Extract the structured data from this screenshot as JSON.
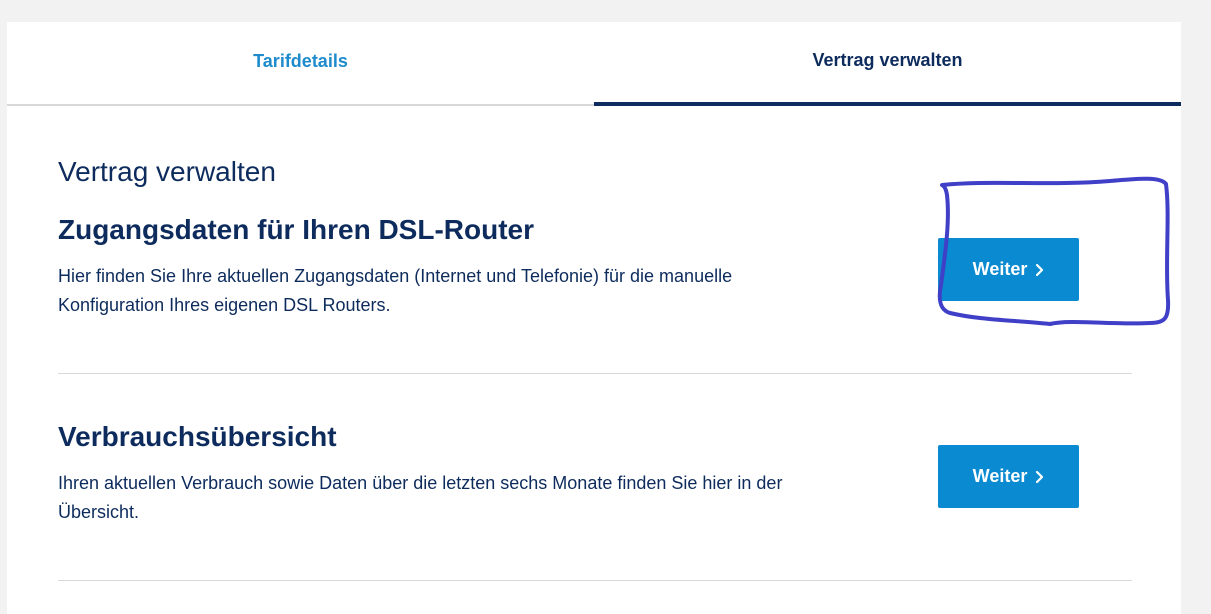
{
  "tabs": [
    {
      "label": "Tarifdetails",
      "active": false
    },
    {
      "label": "Vertrag verwalten",
      "active": true
    }
  ],
  "page_title": "Vertrag verwalten",
  "sections": [
    {
      "title": "Zugangsdaten für Ihren DSL-Router",
      "description": "Hier finden Sie Ihre aktuellen Zugangsdaten (Internet und Telefonie) für die manuelle Konfiguration Ihres eigenen DSL Routers.",
      "button_label": "Weiter"
    },
    {
      "title": "Verbrauchsübersicht",
      "description": "Ihren aktuellen Verbrauch sowie Daten über die letzten sechs Monate finden Sie hier in der Übersicht.",
      "button_label": "Weiter"
    }
  ],
  "icons": {
    "button_icon": "chevron-right-icon"
  },
  "colors": {
    "primary_navy": "#0d2b5c",
    "tab_link": "#1e8bcc",
    "button_blue": "#0a8ad0",
    "annotation_stroke": "#3f3fc8"
  }
}
